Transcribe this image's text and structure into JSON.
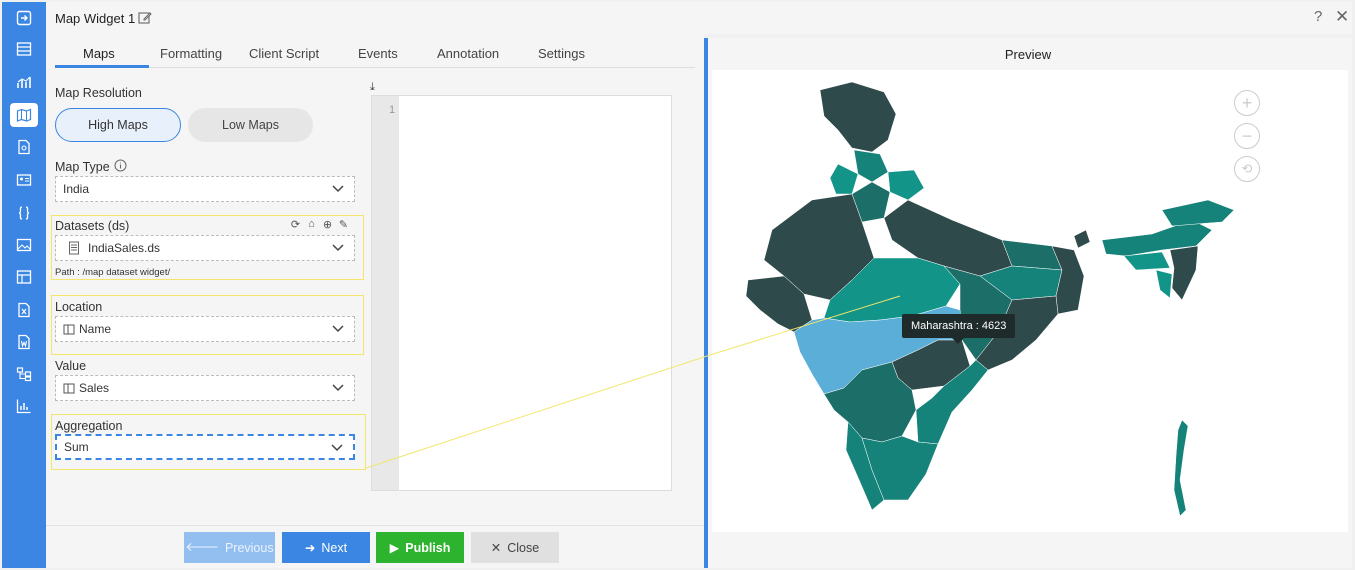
{
  "header": {
    "title": "Map Widget 1",
    "help": "?",
    "close": "✕"
  },
  "tabs": [
    {
      "label": "Maps"
    },
    {
      "label": "Formatting"
    },
    {
      "label": "Client Script"
    },
    {
      "label": "Events"
    },
    {
      "label": "Annotation"
    },
    {
      "label": "Settings"
    }
  ],
  "form": {
    "map_resolution_label": "Map Resolution",
    "high_maps": "High Maps",
    "low_maps": "Low Maps",
    "map_type_label": "Map Type",
    "map_type_value": "India",
    "datasets_label": "Datasets (ds)",
    "datasets_value": "IndiaSales.ds",
    "path": "Path : /map dataset widget/",
    "location_label": "Location",
    "location_value": "Name",
    "value_label": "Value",
    "value_value": "Sales",
    "aggregation_label": "Aggregation",
    "aggregation_value": "Sum"
  },
  "editor": {
    "line": "1"
  },
  "footer": {
    "previous": "Previous",
    "next": "Next",
    "publish": "Publish",
    "close": "Close"
  },
  "preview": {
    "title": "Preview",
    "tooltip": "Maharashtra : 4623"
  },
  "colors": {
    "accent": "#3b86e3",
    "publish": "#2db32d",
    "map_dark": "#2f4a4a",
    "map_teal": "#15837a",
    "map_light": "#5aaed7"
  },
  "rail_icons": [
    "exit-icon",
    "table-icon",
    "chart-icon",
    "map-icon",
    "document-icon",
    "card-icon",
    "braces-icon",
    "image-icon",
    "layout-icon",
    "excel-icon",
    "word-icon",
    "tree-icon",
    "bar-chart-icon"
  ]
}
